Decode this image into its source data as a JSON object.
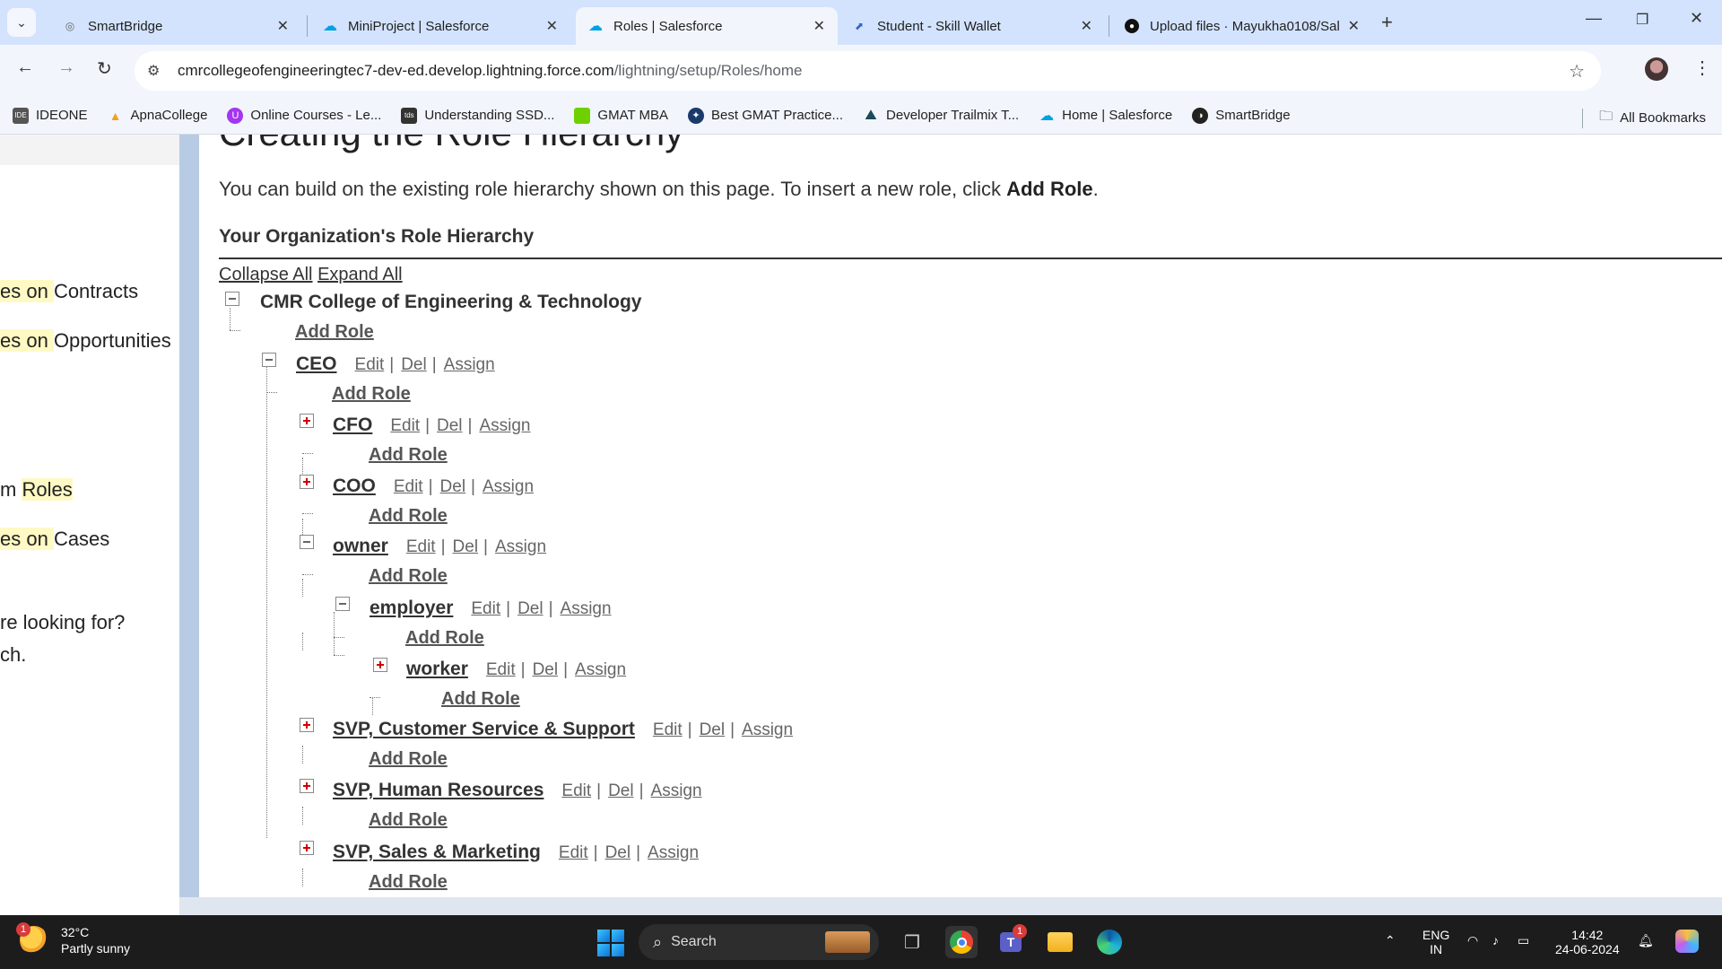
{
  "browser": {
    "tabs": [
      {
        "title": "SmartBridge",
        "icon": "globe-icon",
        "active": false
      },
      {
        "title": "MiniProject | Salesforce",
        "icon": "salesforce-cloud-icon",
        "active": false
      },
      {
        "title": "Roles | Salesforce",
        "icon": "salesforce-cloud-icon",
        "active": true
      },
      {
        "title": "Student - Skill Wallet",
        "icon": "skill-wallet-icon",
        "active": false
      },
      {
        "title": "Upload files · Mayukha0108/Sal",
        "icon": "github-icon",
        "active": false
      }
    ],
    "url_host": "cmrcollegeofengineeringtec7-dev-ed.develop.lightning.force.com",
    "url_path": "/lightning/setup/Roles/home",
    "bookmarks": [
      {
        "label": "IDEONE",
        "icon": "ideone-icon",
        "color": "#555555"
      },
      {
        "label": "ApnaCollege",
        "icon": "apnacollege-icon",
        "color": "#f0a020"
      },
      {
        "label": "Online Courses - Le...",
        "icon": "udemy-icon",
        "color": "#a435f0"
      },
      {
        "label": "Understanding SSD...",
        "icon": "tds-icon",
        "color": "#333333"
      },
      {
        "label": "GMAT MBA",
        "icon": "gmat-icon",
        "color": "#6fd000"
      },
      {
        "label": "Best GMAT Practice...",
        "icon": "gmat-practice-icon",
        "color": "#1a3a6a"
      },
      {
        "label": "Developer Trailmix T...",
        "icon": "trailhead-icon",
        "color": "#1b4a5a"
      },
      {
        "label": "Home | Salesforce",
        "icon": "salesforce-cloud-icon",
        "color": "#00a1e0"
      },
      {
        "label": "SmartBridge",
        "icon": "smartbridge-icon",
        "color": "#222222"
      }
    ],
    "all_bookmarks": "All Bookmarks"
  },
  "sidebar": {
    "items": [
      {
        "prefix": "es on ",
        "highlight": "",
        "suffix": "Contracts"
      },
      {
        "prefix": "es on ",
        "highlight": "",
        "suffix": "Opportunities"
      },
      {
        "prefix": "m ",
        "highlight": "Roles",
        "suffix": ""
      },
      {
        "prefix": "es on ",
        "highlight": "",
        "suffix": "Cases"
      },
      {
        "prefix": "re looking for?",
        "highlight": "",
        "suffix": ""
      },
      {
        "prefix": "ch.",
        "highlight": "",
        "suffix": ""
      }
    ]
  },
  "content": {
    "heading": "Creating the Role Hierarchy",
    "intro_text": "You can build on the existing role hierarchy shown on this page. To insert a new role, click ",
    "intro_bold": "Add Role",
    "intro_end": ".",
    "section_title": "Your Organization's Role Hierarchy",
    "collapse_all": "Collapse All",
    "expand_all": "Expand All",
    "add_role": "Add Role",
    "action_edit": "Edit",
    "action_del": "Del",
    "action_assign": "Assign",
    "root": "CMR College of Engineering & Technology",
    "roles": {
      "ceo": "CEO",
      "cfo": "CFO",
      "coo": "COO",
      "owner": "owner",
      "employer": "employer",
      "worker": "worker",
      "svp_cs": "SVP, Customer Service & Support",
      "svp_hr": "SVP, Human Resources",
      "svp_sm": "SVP, Sales & Marketing"
    }
  },
  "taskbar": {
    "weather_badge": "1",
    "temperature": "32°C",
    "condition": "Partly sunny",
    "search": "Search",
    "teams_badge": "1",
    "lang": "ENG",
    "region": "IN",
    "time": "14:42",
    "date": "24-06-2024"
  }
}
